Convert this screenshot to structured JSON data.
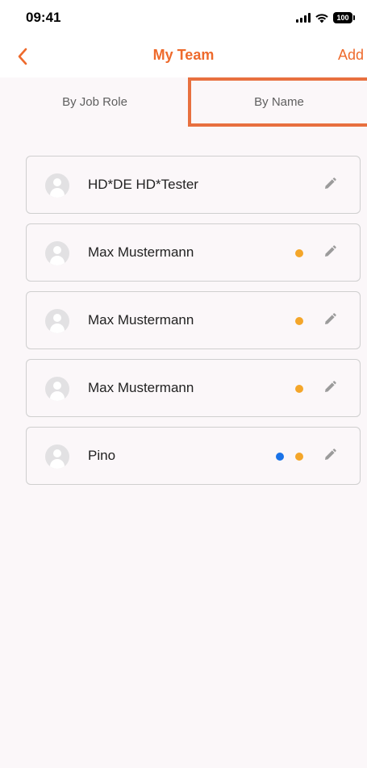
{
  "status_bar": {
    "time": "09:41",
    "battery": "100",
    "icons": [
      "cellular-signal-icon",
      "wifi-icon",
      "battery-icon"
    ]
  },
  "nav": {
    "title": "My Team",
    "add_label": "Add",
    "back_icon": "chevron-left-icon"
  },
  "tabs": [
    {
      "label": "By Job Role",
      "selected": false
    },
    {
      "label": "By Name",
      "selected": true
    }
  ],
  "members": [
    {
      "name": "HD*DE HD*Tester",
      "indicators": []
    },
    {
      "name": "Max Mustermann",
      "indicators": [
        "orange"
      ]
    },
    {
      "name": "Max Mustermann",
      "indicators": [
        "orange"
      ]
    },
    {
      "name": "Max Mustermann",
      "indicators": [
        "orange"
      ]
    },
    {
      "name": "Pino",
      "indicators": [
        "blue",
        "orange"
      ]
    }
  ],
  "colors": {
    "accent": "#EE6A2C",
    "tab_highlight": "#E8703F",
    "background": "#FBF7F9",
    "indicator_orange": "#F4A62A",
    "indicator_blue": "#1A73E8",
    "icon_gray": "#9B9B9B"
  }
}
